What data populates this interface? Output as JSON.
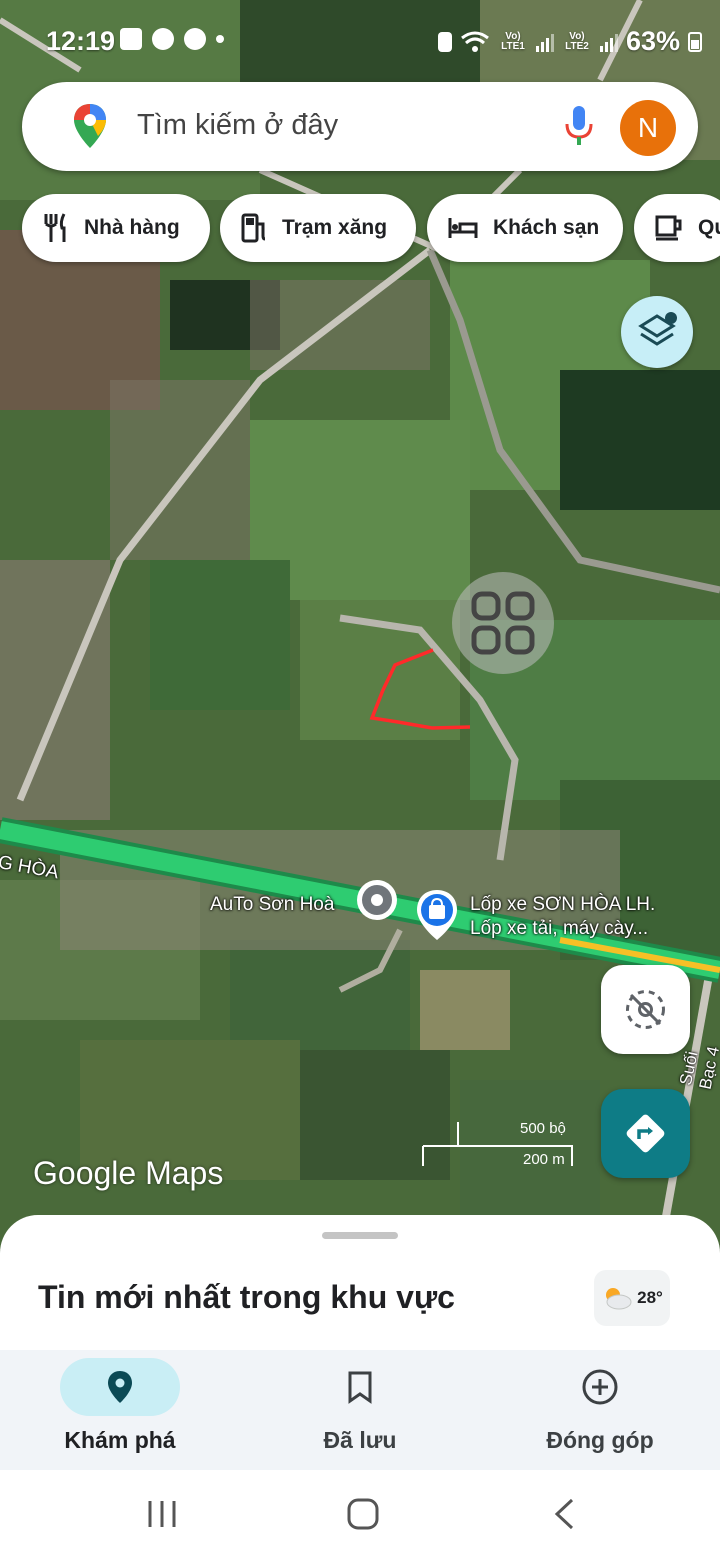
{
  "status_bar": {
    "time": "12:19",
    "left_icons": [
      "gallery-icon",
      "facebook-icon",
      "messenger-icon",
      "dot-icon"
    ],
    "network1": "Vo) LTE1",
    "network2": "Vo) LTE2",
    "battery": "63%"
  },
  "search": {
    "placeholder": "Tìm kiếm ở đây",
    "avatar_initial": "N",
    "avatar_color": "#e8710a"
  },
  "chips": [
    {
      "label": "Nhà hàng",
      "icon": "restaurant-icon"
    },
    {
      "label": "Trạm xăng",
      "icon": "gas-station-icon"
    },
    {
      "label": "Khách sạn",
      "icon": "hotel-icon"
    },
    {
      "label": "Qu",
      "icon": "coffee-icon"
    }
  ],
  "map": {
    "road_label_1": "G HÒA",
    "road_label_2": "Suối Bạc 4",
    "poi_1": "AuTo Sơn Hoà",
    "poi_2_line1": "Lốp xe SƠN HÒA LH.",
    "poi_2_line2": "Lốp xe tải, máy cày...",
    "scale_imperial": "500 bộ",
    "scale_metric": "200 m",
    "watermark": "Google Maps",
    "boundary_color": "#ff2a2a",
    "highway_color": "#2ecc71"
  },
  "sheet": {
    "title": "Tin mới nhất trong khu vực",
    "temperature": "28°"
  },
  "nav": [
    {
      "label": "Khám phá",
      "icon": "explore-pin-icon",
      "active": true
    },
    {
      "label": "Đã lưu",
      "icon": "bookmark-icon",
      "active": false
    },
    {
      "label": "Đóng góp",
      "icon": "add-circle-icon",
      "active": false
    }
  ],
  "accent": "#0e7c86"
}
